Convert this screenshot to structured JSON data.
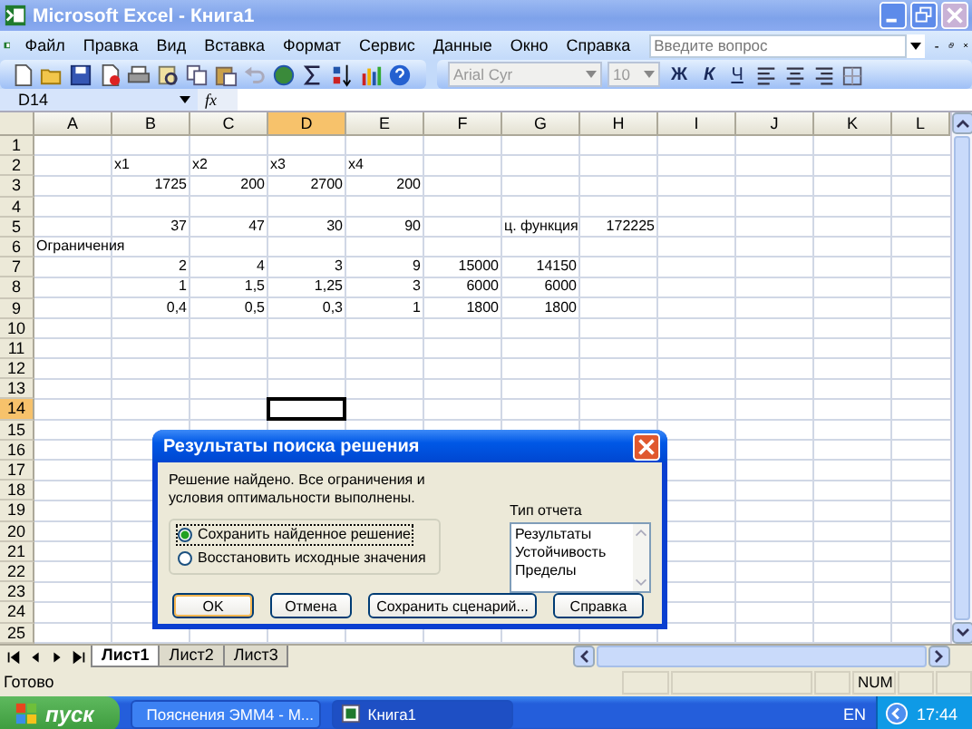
{
  "window": {
    "title": "Microsoft Excel - Книга1"
  },
  "menu": [
    "Файл",
    "Правка",
    "Вид",
    "Вставка",
    "Формат",
    "Сервис",
    "Данные",
    "Окно",
    "Справка"
  ],
  "help_box": {
    "placeholder": "Введите вопрос"
  },
  "toolbar": {
    "font": {
      "value": "Arial Cyr",
      "disabled": true
    },
    "size": {
      "value": "10",
      "disabled": true
    },
    "format_buttons": [
      "Ж",
      "К",
      "Ч"
    ]
  },
  "formula_bar": {
    "name_box": "D14",
    "fx": "fx"
  },
  "sheet": {
    "columns": [
      {
        "label": "A",
        "selected": false
      },
      {
        "label": "B",
        "selected": false
      },
      {
        "label": "C",
        "selected": false
      },
      {
        "label": "D",
        "selected": true
      },
      {
        "label": "E",
        "selected": false
      },
      {
        "label": "F",
        "selected": false
      },
      {
        "label": "G",
        "selected": false
      },
      {
        "label": "H",
        "selected": false
      },
      {
        "label": "I",
        "selected": false
      },
      {
        "label": "J",
        "selected": false
      },
      {
        "label": "K",
        "selected": false
      },
      {
        "label": "L",
        "selected": false
      }
    ],
    "rows": [
      {
        "label": "1",
        "selected": false
      },
      {
        "label": "2",
        "selected": false,
        "cells": [
          null,
          {
            "text": "x1",
            "kind": "text"
          },
          {
            "text": "x2",
            "kind": "text"
          },
          {
            "text": "x3",
            "kind": "text"
          },
          {
            "text": "x4",
            "kind": "text"
          }
        ]
      },
      {
        "label": "3",
        "selected": false,
        "cells": [
          null,
          {
            "text": "1725",
            "kind": "number"
          },
          {
            "text": "200",
            "kind": "number"
          },
          {
            "text": "2700",
            "kind": "number"
          },
          {
            "text": "200",
            "kind": "number"
          }
        ]
      },
      {
        "label": "4",
        "selected": false
      },
      {
        "label": "5",
        "selected": false,
        "cells": [
          null,
          {
            "text": "37",
            "kind": "number"
          },
          {
            "text": "47",
            "kind": "number"
          },
          {
            "text": "30",
            "kind": "number"
          },
          {
            "text": "90",
            "kind": "number"
          },
          null,
          {
            "text": "ц. функция",
            "kind": "text"
          },
          {
            "text": "172225",
            "kind": "number"
          }
        ]
      },
      {
        "label": "6",
        "selected": false,
        "cells": [
          {
            "text": "Ограничения",
            "kind": "text"
          }
        ]
      },
      {
        "label": "7",
        "selected": false,
        "cells": [
          null,
          {
            "text": "2",
            "kind": "number"
          },
          {
            "text": "4",
            "kind": "number"
          },
          {
            "text": "3",
            "kind": "number"
          },
          {
            "text": "9",
            "kind": "number"
          },
          {
            "text": "15000",
            "kind": "number"
          },
          {
            "text": "14150",
            "kind": "number"
          }
        ]
      },
      {
        "label": "8",
        "selected": false,
        "cells": [
          null,
          {
            "text": "1",
            "kind": "number"
          },
          {
            "text": "1,5",
            "kind": "number"
          },
          {
            "text": "1,25",
            "kind": "number"
          },
          {
            "text": "3",
            "kind": "number"
          },
          {
            "text": "6000",
            "kind": "number"
          },
          {
            "text": "6000",
            "kind": "number"
          }
        ]
      },
      {
        "label": "9",
        "selected": false,
        "cells": [
          null,
          {
            "text": "0,4",
            "kind": "number"
          },
          {
            "text": "0,5",
            "kind": "number"
          },
          {
            "text": "0,3",
            "kind": "number"
          },
          {
            "text": "1",
            "kind": "number"
          },
          {
            "text": "1800",
            "kind": "number"
          },
          {
            "text": "1800",
            "kind": "number"
          }
        ]
      },
      {
        "label": "10",
        "selected": false
      },
      {
        "label": "11",
        "selected": false
      },
      {
        "label": "12",
        "selected": false
      },
      {
        "label": "13",
        "selected": false
      },
      {
        "label": "14",
        "selected": true
      },
      {
        "label": "15",
        "selected": false
      },
      {
        "label": "16",
        "selected": false
      },
      {
        "label": "17",
        "selected": false
      },
      {
        "label": "18",
        "selected": false
      },
      {
        "label": "19",
        "selected": false
      },
      {
        "label": "20",
        "selected": false
      },
      {
        "label": "21",
        "selected": false
      },
      {
        "label": "22",
        "selected": false
      },
      {
        "label": "23",
        "selected": false
      },
      {
        "label": "24",
        "selected": false
      },
      {
        "label": "25",
        "selected": false
      }
    ]
  },
  "dialog": {
    "title": "Результаты поиска решения",
    "message": "Решение найдено. Все ограничения и условия оптимальности выполнены.",
    "options": [
      {
        "label": "Сохранить найденное решение",
        "selected": true
      },
      {
        "label": "Восстановить исходные значения",
        "selected": false
      }
    ],
    "report_label": "Тип отчета",
    "report_types": [
      "Результаты",
      "Устойчивость",
      "Пределы"
    ],
    "buttons": [
      {
        "label": "OK",
        "default": true
      },
      {
        "label": "Отмена",
        "default": false
      },
      {
        "label": "Сохранить сценарий...",
        "default": false
      },
      {
        "label": "Справка",
        "default": false
      }
    ]
  },
  "sheet_tabs": [
    {
      "label": "Лист1",
      "selected": true
    },
    {
      "label": "Лист2",
      "selected": false
    },
    {
      "label": "Лист3",
      "selected": false
    }
  ],
  "status_bar": {
    "text": "Готово",
    "indicator": "NUM"
  },
  "taskbar": {
    "start": "пуск",
    "tasks": [
      {
        "label": "Пояснения ЭММ4 - М...",
        "selected": false
      },
      {
        "label": "Книга1",
        "selected": true
      }
    ],
    "language": "EN",
    "clock": "17:44"
  }
}
